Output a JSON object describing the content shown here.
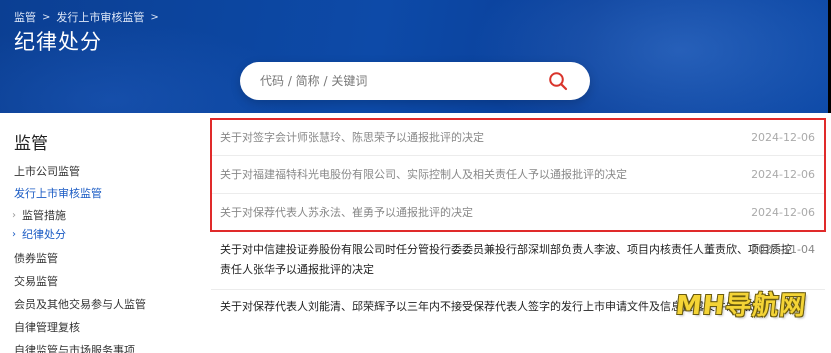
{
  "breadcrumb": [
    "监管",
    "发行上市审核监管"
  ],
  "page_title": "纪律处分",
  "search": {
    "placeholder": "代码 / 简称 / 关键词"
  },
  "sidebar": {
    "title": "监管",
    "items": [
      {
        "label": "上市公司监管"
      },
      {
        "label": "发行上市审核监管",
        "active": true
      },
      {
        "label": "监管措施",
        "sub": true
      },
      {
        "label": "纪律处分",
        "sub": true,
        "active": true
      },
      {
        "label": "债券监管"
      },
      {
        "label": "交易监管"
      },
      {
        "label": "会员及其他交易参与人监管"
      },
      {
        "label": "自律管理复核"
      },
      {
        "label": "自律监管与市场服务事项"
      }
    ]
  },
  "list": [
    {
      "title": "关于对签字会计师张慧玲、陈思荣予以通报批评的决定",
      "date": "2024-12-06",
      "highlighted": true
    },
    {
      "title": "关于对福建福特科光电股份有限公司、实际控制人及相关责任人予以通报批评的决定",
      "date": "2024-12-06",
      "highlighted": true
    },
    {
      "title": "关于对保荐代表人苏永法、崔勇予以通报批评的决定",
      "date": "2024-12-06",
      "highlighted": true
    },
    {
      "title": "关于对中信建投证券股份有限公司时任分管投行委委员兼投行部深圳部负责人李波、项目内核责任人董责欣、项目质控责任人张华予以通报批评的决定",
      "date": "2024-11-04",
      "highlighted": false
    },
    {
      "title": "关于对保荐代表人刘能清、邱荣辉予以三年内不接受保荐代表人签字的发行上市申请文件及信息披露文件的决定",
      "date": "",
      "highlighted": false
    }
  ],
  "watermark": "MH导航网",
  "colors": {
    "banner": "#0d4aa8",
    "active_link": "#1a5bc4",
    "highlight_border": "#e02a2a",
    "search_icon": "#d9342b"
  }
}
